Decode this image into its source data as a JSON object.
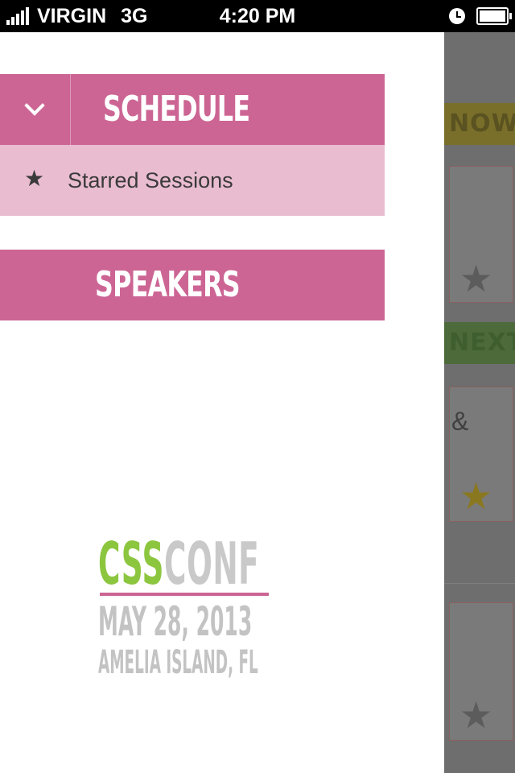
{
  "status_bar": {
    "carrier": "VIRGIN",
    "network": "3G",
    "time": "4:20 PM",
    "icons": [
      "signal-icon",
      "clock-icon",
      "battery-icon"
    ]
  },
  "menu": {
    "schedule_label": "SCHEDULE",
    "starred_sessions_label": "Starred Sessions",
    "speakers_label": "SPEAKERS"
  },
  "logo": {
    "word_css": "CSS",
    "word_conf": "CONF",
    "date": "MAY 28, 2013",
    "location": "AMELIA ISLAND, FL"
  },
  "background_view": {
    "tag_now": "NOW",
    "tag_next": "NEXT",
    "card_fragment": "&"
  },
  "colors": {
    "accent_pink": "#cc6594",
    "light_pink": "#e9bcd0",
    "logo_green": "#8cc63f",
    "logo_grey": "#c3c3c3"
  }
}
